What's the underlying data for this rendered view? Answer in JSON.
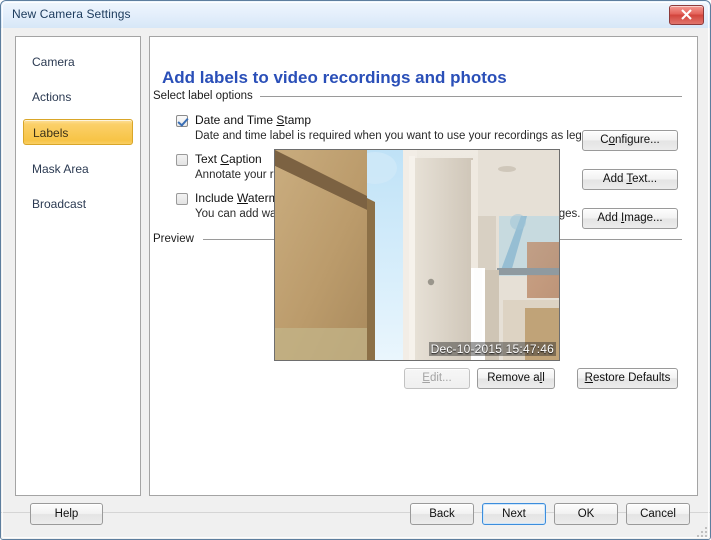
{
  "window": {
    "title": "New Camera Settings",
    "close_icon": "close-icon"
  },
  "sidebar": {
    "items": [
      {
        "label": "Camera",
        "selected": false
      },
      {
        "label": "Actions",
        "selected": false
      },
      {
        "label": "Labels",
        "selected": true
      },
      {
        "label": "Mask Area",
        "selected": false
      },
      {
        "label": "Broadcast",
        "selected": false
      }
    ]
  },
  "main": {
    "heading": "Add labels to video recordings and photos",
    "options_group": {
      "label": "Select label options",
      "options": [
        {
          "title_pre": "Date and Time ",
          "title_mnemonic": "S",
          "title_post": "tamp",
          "description": "Date and time label is required when you want to use your recordings as legal proof.",
          "checked": true,
          "button": {
            "pre": "C",
            "mnemonic": "o",
            "post": "nfigure..."
          }
        },
        {
          "title_pre": "Text ",
          "title_mnemonic": "C",
          "title_post": "aption",
          "description": "Annotate your recordings and photos with text captions.",
          "checked": false,
          "button": {
            "pre": "Add ",
            "mnemonic": "T",
            "post": "ext..."
          }
        },
        {
          "title_pre": "Include ",
          "title_mnemonic": "W",
          "title_post": "atermark",
          "description": "You can add watermarks to your recording or photos using different images.",
          "checked": false,
          "button": {
            "pre": "Add ",
            "mnemonic": "I",
            "post": "mage..."
          }
        }
      ]
    },
    "preview_group": {
      "label": "Preview",
      "timestamp_overlay": "Dec-10-2015 15:47:46",
      "buttons": {
        "edit": {
          "pre": "",
          "mnemonic": "E",
          "post": "dit...",
          "disabled": true
        },
        "remove_all": {
          "pre": "Remove a",
          "mnemonic": "l",
          "post": "l",
          "disabled": false
        },
        "restore_defaults": {
          "pre": "",
          "mnemonic": "R",
          "post": "estore Defaults",
          "disabled": false
        }
      }
    }
  },
  "footer": {
    "help": "Help",
    "back": "Back",
    "next": "Next",
    "ok": "OK",
    "cancel": "Cancel"
  }
}
